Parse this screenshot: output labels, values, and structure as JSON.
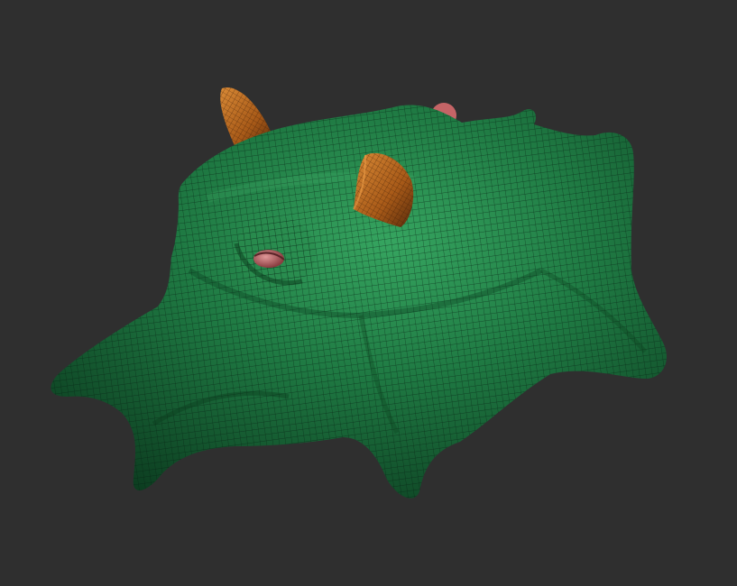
{
  "viewport": {
    "background": "#2f2f2f",
    "render_mode": "wireframe-over-polypaint"
  },
  "model": {
    "colors": {
      "body": "#1f7a43",
      "body_light": "#2f9a58",
      "body_dark": "#0f4a26",
      "wire": "#0a2a16",
      "ear": "#b8641c",
      "ear_dark": "#6a3410",
      "eye": "#c06a6a",
      "eye_dark": "#7a3438",
      "nub": "#c46466"
    },
    "parts": [
      "body",
      "left-ear",
      "right-ear",
      "left-eye",
      "top-nub"
    ]
  }
}
